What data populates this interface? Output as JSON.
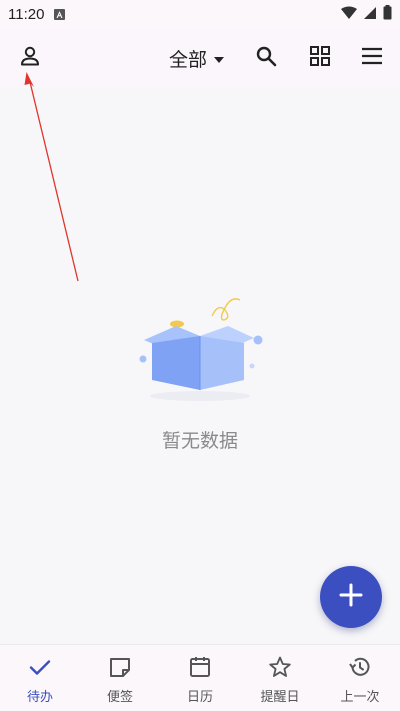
{
  "status_bar": {
    "time": "11:20",
    "icons": [
      "a-icon",
      "wifi-icon",
      "signal-icon",
      "battery-icon"
    ]
  },
  "app_bar": {
    "filter_label": "全部",
    "icons": [
      "user-icon",
      "caret-down-icon",
      "search-icon",
      "grid-view-icon",
      "menu-icon"
    ]
  },
  "empty_state": {
    "message": "暂无数据",
    "icon": "empty-box-illustration"
  },
  "fab": {
    "icon": "plus-icon"
  },
  "bottom_nav": {
    "items": [
      {
        "label": "待办",
        "icon": "check-icon",
        "active": true
      },
      {
        "label": "便签",
        "icon": "note-icon",
        "active": false
      },
      {
        "label": "日历",
        "icon": "calendar-icon",
        "active": false
      },
      {
        "label": "提醒日",
        "icon": "star-icon",
        "active": false
      },
      {
        "label": "上一次",
        "icon": "history-icon",
        "active": false
      }
    ]
  },
  "colors": {
    "accent": "#3c4fc1",
    "bar_background": "#fbf6fc",
    "page_background": "#f7f7f9",
    "annotation": "#e0352b",
    "empty_text": "#8a8a8a"
  }
}
